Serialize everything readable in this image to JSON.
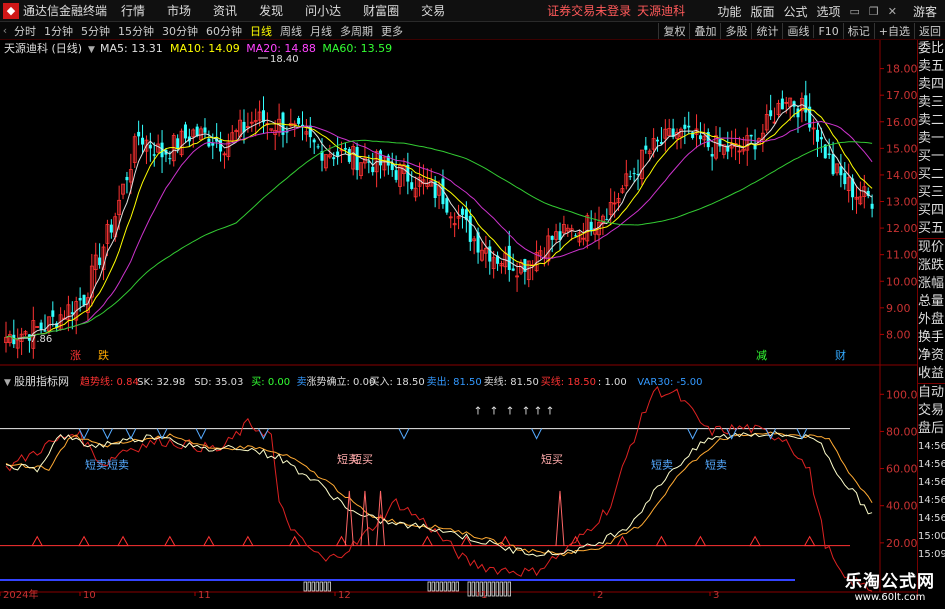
{
  "menubar": {
    "app_title": "通达信金融终端",
    "items": [
      "行情",
      "市场",
      "资讯",
      "发现",
      "问小达",
      "财富圈",
      "交易"
    ],
    "warning": "证券交易未登录",
    "stock_link": "天源迪科",
    "right_items": [
      "功能",
      "版面",
      "公式",
      "选项"
    ],
    "guest": "游客"
  },
  "toolbar": {
    "periods": [
      "分时",
      "1分钟",
      "5分钟",
      "15分钟",
      "30分钟",
      "60分钟",
      "日线",
      "周线",
      "月线",
      "多周期",
      "更多"
    ],
    "active_period": "日线",
    "right_items": [
      "复权",
      "叠加",
      "多股",
      "统计",
      "画线",
      "F10",
      "标记",
      "+自选",
      "返回"
    ]
  },
  "main_legend": {
    "title": "天源迪科 (日线)",
    "ma": [
      {
        "label": "MA5: 13.31",
        "color": "#e0e0e0"
      },
      {
        "label": "MA10: 14.09",
        "color": "#ffff00"
      },
      {
        "label": "MA20: 14.88",
        "color": "#ff44ff"
      },
      {
        "label": "MA60: 13.59",
        "color": "#33ff33"
      }
    ]
  },
  "annotations": {
    "high": "18.40",
    "low": "7.86"
  },
  "markers": [
    {
      "text": "涨",
      "color": "#ff3333"
    },
    {
      "text": "跌",
      "color": "#ffaa00"
    },
    {
      "text": "减",
      "color": "#33ff33"
    },
    {
      "text": "财",
      "color": "#33aaff"
    }
  ],
  "sub_legend": {
    "name": "股朋指标网",
    "fields": [
      {
        "label": "趋势线: 0.84",
        "color": "#ff3333"
      },
      {
        "label": "SK: 32.98",
        "color": "#dddddd"
      },
      {
        "label": "SD: 35.03",
        "color": "#dddddd"
      },
      {
        "label": "买: 0.00",
        "color": "#33ff33"
      },
      {
        "label": "卖",
        "color": "#3399ff"
      },
      {
        "label": "涨势确立: 0.00",
        "color": "#dddddd"
      },
      {
        "label": "买入: 18.50",
        "color": "#dddddd"
      },
      {
        "label": "卖出: 81.50",
        "color": "#3399ff"
      },
      {
        "label": "卖线: 81.50",
        "color": "#dddddd"
      },
      {
        "label": "买线: 18.50",
        "color": "#ff3333"
      },
      {
        "label": ": 1.00",
        "color": "#dddddd"
      },
      {
        "label": "VAR30: -5.00",
        "color": "#3399ff"
      }
    ]
  },
  "signal_labels": {
    "short_sell": "短卖",
    "short_buy": "短买",
    "arrow": "↑"
  },
  "x_labels": [
    "2024年",
    "10",
    "11",
    "12",
    "1",
    "2",
    "3"
  ],
  "price_axis": [
    "18.00",
    "17.00",
    "16.00",
    "15.00",
    "14.00",
    "13.00",
    "12.00",
    "11.00",
    "10.00",
    "9.00",
    "8.00"
  ],
  "sub_axis": [
    "100.0",
    "80.00",
    "60.00",
    "40.00",
    "20.00"
  ],
  "side_panel": [
    "委比",
    "卖五",
    "卖四",
    "卖三",
    "卖二",
    "卖一",
    "买一",
    "买二",
    "买三",
    "买四",
    "买五",
    "现价",
    "涨跌",
    "涨幅",
    "总量",
    "外盘",
    "换手",
    "净资",
    "收益",
    "自动",
    "交易",
    "盘后",
    "14:56",
    "14:56",
    "14:56",
    "14:56",
    "14:56",
    "15:00",
    "15:09"
  ],
  "watermark": {
    "title": "乐淘公式网",
    "url": "www.60lt.com"
  },
  "colors": {
    "up": "#ff3333",
    "down": "#33ffff",
    "ma5": "#e0e0e0",
    "ma10": "#ffff00",
    "ma20": "#cc33cc",
    "ma60": "#33cc33",
    "sk": "#ffffcc",
    "sd": "#ffaa33",
    "trend": "#dd2222"
  }
}
